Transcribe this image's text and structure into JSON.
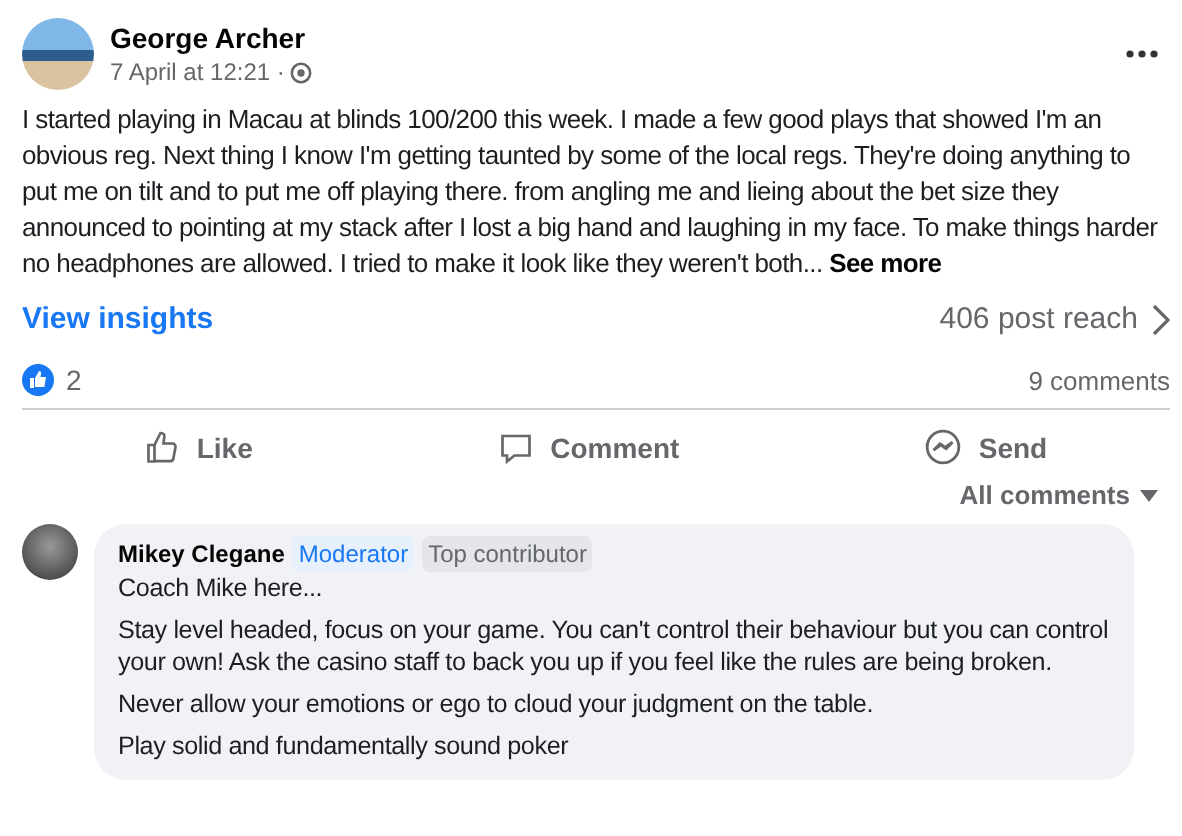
{
  "post": {
    "author": "George Archer",
    "time": "7 April at 12:21 ·",
    "body": "I started playing in Macau at blinds 100/200 this week. I made a few good plays that showed I'm an obvious reg. Next thing I know I'm getting taunted by some of the local regs. They're doing anything to put me on tilt and to put me off playing there. from angling me and lieing about the bet size they announced to pointing at my stack after I lost a big hand and laughing in my face. To make things harder no headphones are allowed. I tried to make it look like they weren't both...",
    "see_more": "See more"
  },
  "insights": {
    "link": "View insights",
    "reach": "406 post reach"
  },
  "reactions": {
    "count": "2",
    "comments": "9 comments"
  },
  "actions": [
    {
      "kind": "like",
      "label": "Like"
    },
    {
      "kind": "comment",
      "label": "Comment"
    },
    {
      "kind": "send",
      "label": "Send"
    }
  ],
  "sort": "All comments",
  "comment": {
    "author": "Mikey Clegane",
    "badges": [
      {
        "label": "Moderator",
        "kind": "moderator"
      },
      {
        "label": "Top contributor",
        "kind": "contributor"
      }
    ],
    "paragraphs": [
      "Coach Mike here...",
      "Stay level headed, focus on your game. You can't control their behaviour but you can control your own! Ask the casino staff to back you up if you feel like the rules are being broken.",
      "Never allow your emotions or ego to cloud your judgment on the table.",
      "Play solid and fundamentally sound poker"
    ]
  }
}
